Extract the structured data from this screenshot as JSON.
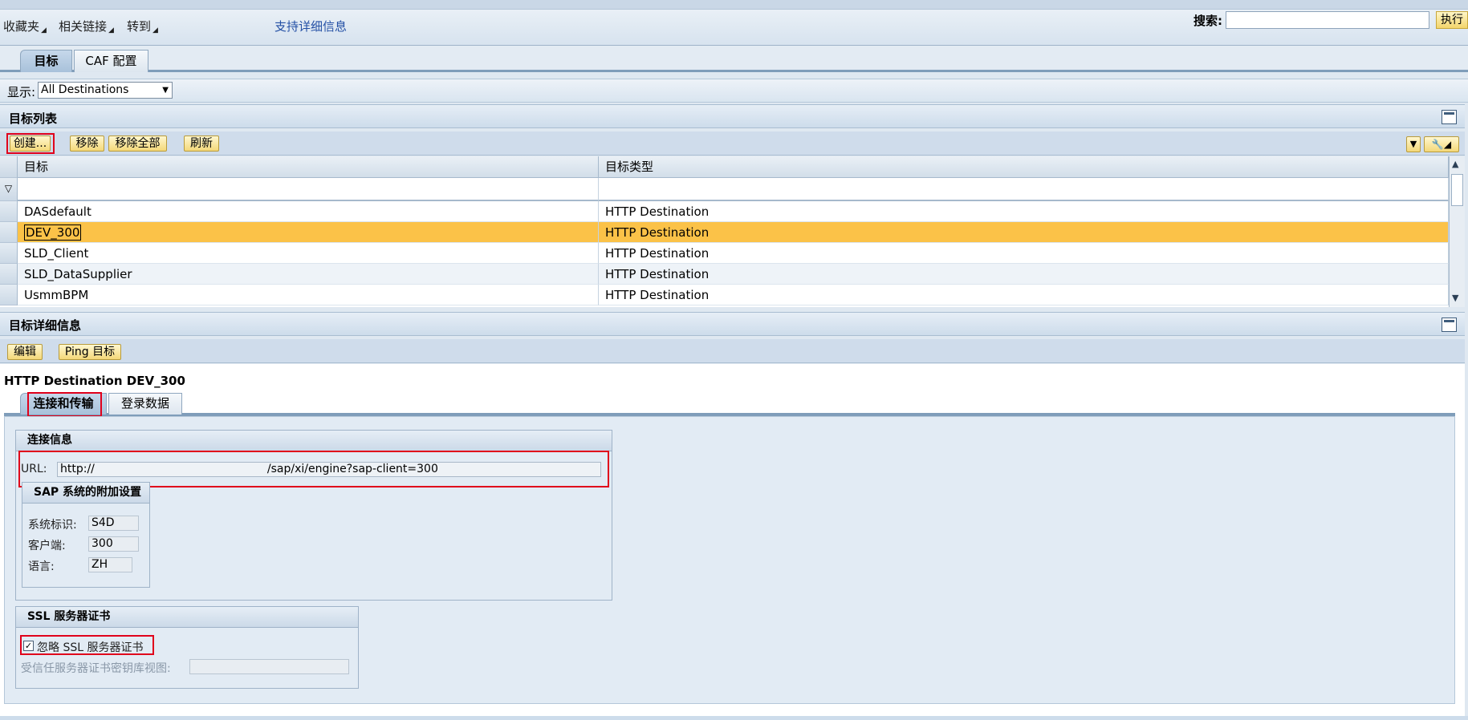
{
  "top_menu": {
    "favorites": "收藏夹",
    "related_links": "相关链接",
    "goto": "转到",
    "support_details": "支持详细信息",
    "search_label": "搜索:",
    "search_value": "",
    "execute": "执行"
  },
  "tabs": {
    "target": "目标",
    "caf": "CAF 配置"
  },
  "display": {
    "label": "显示:",
    "selected": "All Destinations"
  },
  "target_list": {
    "title": "目标列表",
    "buttons": {
      "create": "创建...",
      "remove": "移除",
      "remove_all": "移除全部",
      "refresh": "刷新"
    },
    "columns": [
      "目标",
      "目标类型"
    ],
    "rows": [
      {
        "name": "DASdefault",
        "type": "HTTP Destination"
      },
      {
        "name": "DEV_300",
        "type": "HTTP Destination"
      },
      {
        "name": "SLD_Client",
        "type": "HTTP Destination"
      },
      {
        "name": "SLD_DataSupplier",
        "type": "HTTP Destination"
      },
      {
        "name": "UsmmBPM",
        "type": "HTTP Destination"
      }
    ],
    "selected_row": 1
  },
  "target_details": {
    "title": "目标详细信息",
    "buttons": {
      "edit": "编辑",
      "ping": "Ping 目标"
    },
    "destination_title": "HTTP Destination DEV_300",
    "tabs": {
      "connection": "连接和传输",
      "login": "登录数据"
    },
    "connection_info": {
      "title": "连接信息",
      "url_label": "URL:",
      "url_prefix": "http://",
      "url_suffix": "/sap/xi/engine?sap-client=300"
    },
    "sap_settings": {
      "title": "SAP 系统的附加设置",
      "system_id_label": "系统标识:",
      "system_id": "S4D",
      "client_label": "客户端:",
      "client": "300",
      "language_label": "语言:",
      "language": "ZH"
    },
    "ssl": {
      "title": "SSL 服务器证书",
      "ignore_label": "忽略 SSL 服务器证书",
      "ignore_checked": true,
      "keystore_label": "受信任服务器证书密钥库视图:",
      "keystore_value": ""
    }
  }
}
